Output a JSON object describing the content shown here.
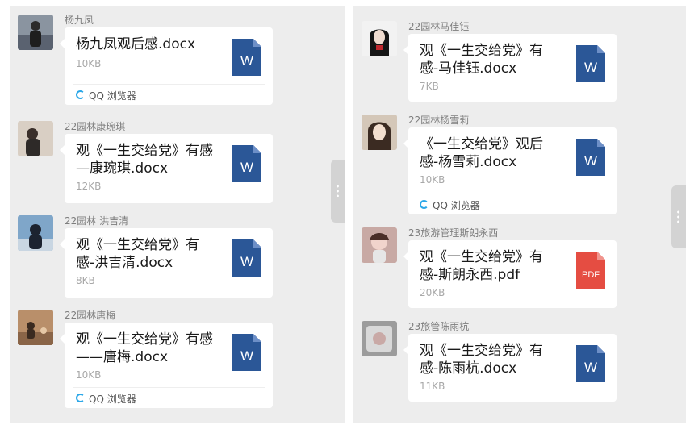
{
  "left_panel": {
    "messages": [
      {
        "sender": "杨九凤",
        "file_name": "杨九凤观后感.docx",
        "file_size": "10KB",
        "file_type": "word",
        "source": "QQ 浏览器"
      },
      {
        "sender": "22园林康琬琪",
        "file_name": "观《一生交给党》有感—康琬琪.docx",
        "file_size": "12KB",
        "file_type": "word",
        "source": ""
      },
      {
        "sender": "22园林 洪吉清",
        "file_name": "观《一生交给党》有感-洪吉清.docx",
        "file_size": "8KB",
        "file_type": "word",
        "source": ""
      },
      {
        "sender": "22园林唐梅",
        "file_name": "观《一生交给党》有感——唐梅.docx",
        "file_size": "10KB",
        "file_type": "word",
        "source": "QQ 浏览器"
      }
    ]
  },
  "right_panel": {
    "messages": [
      {
        "sender": "22园林马佳钰",
        "file_name": "观《一生交给党》有感-马佳钰.docx",
        "file_size": "7KB",
        "file_type": "word",
        "source": ""
      },
      {
        "sender": "22园林杨雪莉",
        "file_name": "《一生交给党》观后感-杨雪莉.docx",
        "file_size": "10KB",
        "file_type": "word",
        "source": "QQ 浏览器"
      },
      {
        "sender": "23旅游管理斯朗永西",
        "file_name": "观《一生交给党》有感-斯朗永西.pdf",
        "file_size": "20KB",
        "file_type": "pdf",
        "source": ""
      },
      {
        "sender": "23旅管陈雨杭",
        "file_name": "观《一生交给党》有感-陈雨杭.docx",
        "file_size": "11KB",
        "file_type": "word",
        "source": ""
      }
    ]
  },
  "icons": {
    "word": "W",
    "pdf": "PDF"
  },
  "colors": {
    "word_blue": "#2b5797",
    "pdf_red": "#e54d42",
    "qq_blue": "#2aa7e8",
    "chat_bg": "#ededed"
  }
}
